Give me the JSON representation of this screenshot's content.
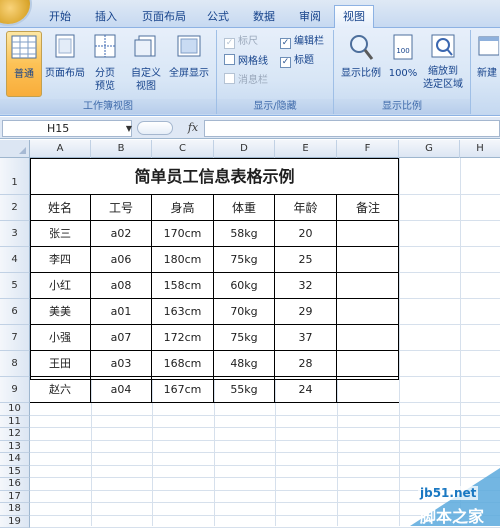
{
  "tabs": [
    {
      "label": "开始",
      "active": false
    },
    {
      "label": "插入",
      "active": false
    },
    {
      "label": "页面布局",
      "active": false
    },
    {
      "label": "公式",
      "active": false
    },
    {
      "label": "数据",
      "active": false
    },
    {
      "label": "审阅",
      "active": false
    },
    {
      "label": "视图",
      "active": true
    }
  ],
  "ribbon": {
    "workbook_views": {
      "group_label": "工作簿视图",
      "normal": "普通",
      "page_layout": "页面布局",
      "page_break_preview_1": "分页",
      "page_break_preview_2": "预览",
      "custom_views_1": "自定义",
      "custom_views_2": "视图",
      "full_screen": "全屏显示"
    },
    "show_hide": {
      "group_label": "显示/隐藏",
      "ruler": "标尺",
      "gridlines": "网格线",
      "message_bar": "消息栏",
      "formula_bar": "编辑栏",
      "headings": "标题"
    },
    "zoom": {
      "group_label": "显示比例",
      "zoom": "显示比例",
      "hundred": "100%",
      "zoom_to_selection_1": "缩放到",
      "zoom_to_selection_2": "选定区域"
    },
    "window": {
      "new_window": "新建"
    }
  },
  "formula_bar": {
    "name_box": "H15",
    "fx": "fx",
    "value": ""
  },
  "columns": [
    "A",
    "B",
    "C",
    "D",
    "E",
    "F",
    "G",
    "H"
  ],
  "rows": [
    "1",
    "2",
    "3",
    "4",
    "5",
    "6",
    "7",
    "8",
    "9",
    "10",
    "11",
    "12",
    "13",
    "14",
    "15",
    "16",
    "17",
    "18",
    "19"
  ],
  "sheet": {
    "title": "简单员工信息表格示例",
    "headers": [
      "姓名",
      "工号",
      "身高",
      "体重",
      "年龄",
      "备注"
    ],
    "records": [
      [
        "张三",
        "a02",
        "170cm",
        "58kg",
        "20",
        ""
      ],
      [
        "李四",
        "a06",
        "180cm",
        "75kg",
        "25",
        ""
      ],
      [
        "小红",
        "a08",
        "158cm",
        "60kg",
        "32",
        ""
      ],
      [
        "美美",
        "a01",
        "163cm",
        "70kg",
        "29",
        ""
      ],
      [
        "小强",
        "a07",
        "172cm",
        "75kg",
        "37",
        ""
      ],
      [
        "王田",
        "a03",
        "168cm",
        "48kg",
        "28",
        ""
      ],
      [
        "赵六",
        "a04",
        "167cm",
        "55kg",
        "24",
        ""
      ]
    ]
  },
  "watermark": {
    "url": "jb51.net",
    "text": "脚本之家"
  },
  "colors": {
    "ribbon_accent": "#15428b",
    "active_button": "#fcc256",
    "header_fill": "#dce6f3"
  }
}
